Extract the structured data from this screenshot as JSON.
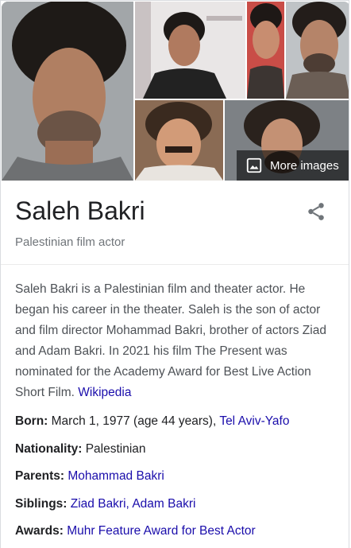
{
  "gallery": {
    "more_images_label": "More images"
  },
  "entity": {
    "name": "Saleh Bakri",
    "type": "Palestinian film actor"
  },
  "description": {
    "text": "Saleh Bakri is a Palestinian film and theater actor. He began his career in the theater. Saleh is the son of actor and film director Mohammad Bakri, brother of actors Ziad and Adam Bakri. In 2021 his film The Present was nominated for the Academy Award for Best Live Action Short Film.",
    "source_link": "Wikipedia"
  },
  "facts": {
    "born": {
      "label": "Born:",
      "text": "March 1, 1977 (age 44 years),",
      "link": "Tel Aviv-Yafo"
    },
    "nationality": {
      "label": "Nationality:",
      "text": "Palestinian"
    },
    "parents": {
      "label": "Parents:",
      "link": "Mohammad Bakri"
    },
    "siblings": {
      "label": "Siblings:",
      "link1": "Ziad Bakri",
      "sep": ", ",
      "link2": "Adam Bakri"
    },
    "awards": {
      "label": "Awards:",
      "link": "Muhr Feature Award for Best Actor"
    }
  },
  "colors": {
    "link": "#1a0dab",
    "text": "#202124",
    "muted": "#70757a"
  },
  "icons": {
    "share": "share-icon",
    "more_images": "image-icon"
  }
}
